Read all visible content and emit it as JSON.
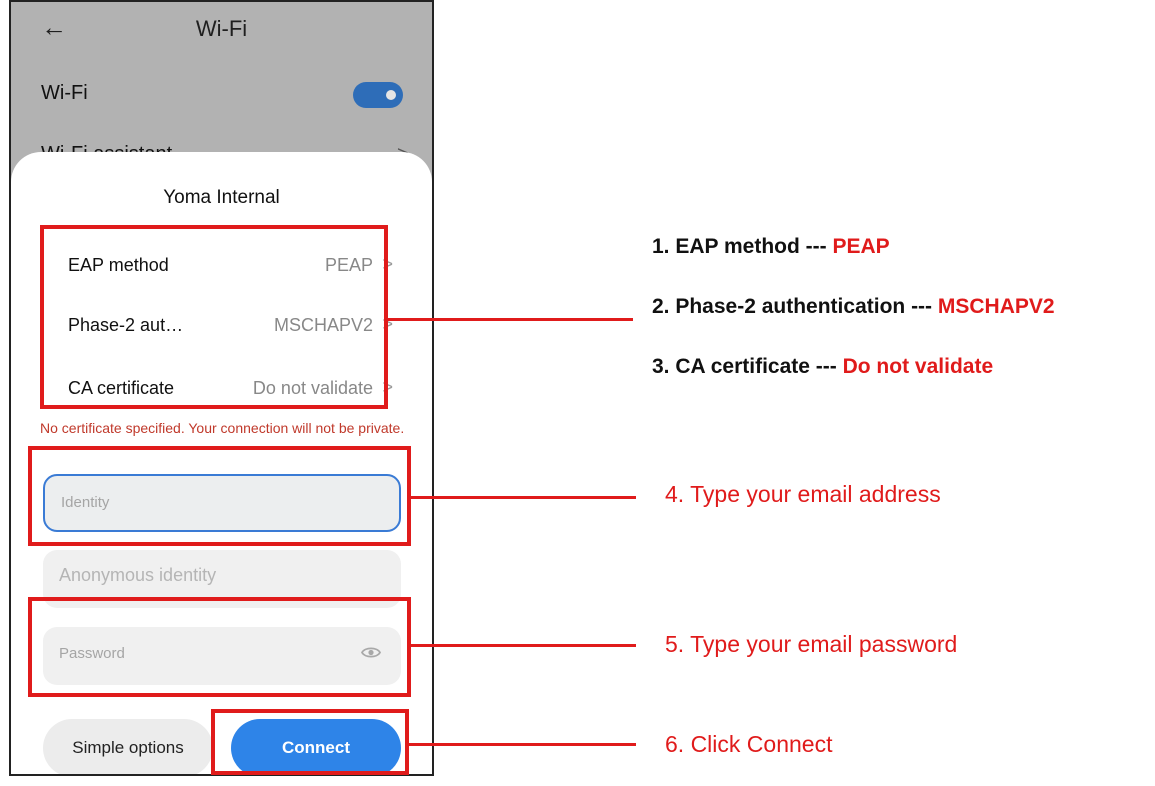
{
  "topbar": {
    "back_icon": "arrow-left-icon",
    "back_glyph": "←",
    "title": "Wi-Fi"
  },
  "wifi_row": {
    "label": "Wi-Fi",
    "toggle_on": true
  },
  "assistant_row": {
    "label": "Wi-Fi assistant",
    "chevron": ">"
  },
  "dialog": {
    "title": "Yoma Internal",
    "options": [
      {
        "label": "EAP method",
        "value": "PEAP"
      },
      {
        "label": "Phase-2 aut…",
        "value": "MSCHAPV2"
      },
      {
        "label": "CA certificate",
        "value": "Do not validate"
      }
    ],
    "chevron": ">",
    "warning": "No certificate specified. Your connection will not be private.",
    "identity_placeholder": "Identity",
    "anonymous_placeholder": "Anonymous identity",
    "password_placeholder": "Password",
    "simple_button": "Simple options",
    "connect_button": "Connect"
  },
  "annotations": [
    {
      "num": "1. EAP method",
      "sep": " --- ",
      "value": "PEAP"
    },
    {
      "num": "2. Phase-2 authentication",
      "sep": " --- ",
      "value": "MSCHAPV2"
    },
    {
      "num": "3. CA certificate",
      "sep": " --- ",
      "value": "Do not validate"
    }
  ],
  "steps": {
    "s4": "4. Type your email address",
    "s5": "5. Type your email password",
    "s6": "6. Click Connect"
  },
  "colors": {
    "highlight_red": "#e01b1b",
    "accent_blue": "#2e84e8",
    "warning_red": "#c0392b"
  }
}
